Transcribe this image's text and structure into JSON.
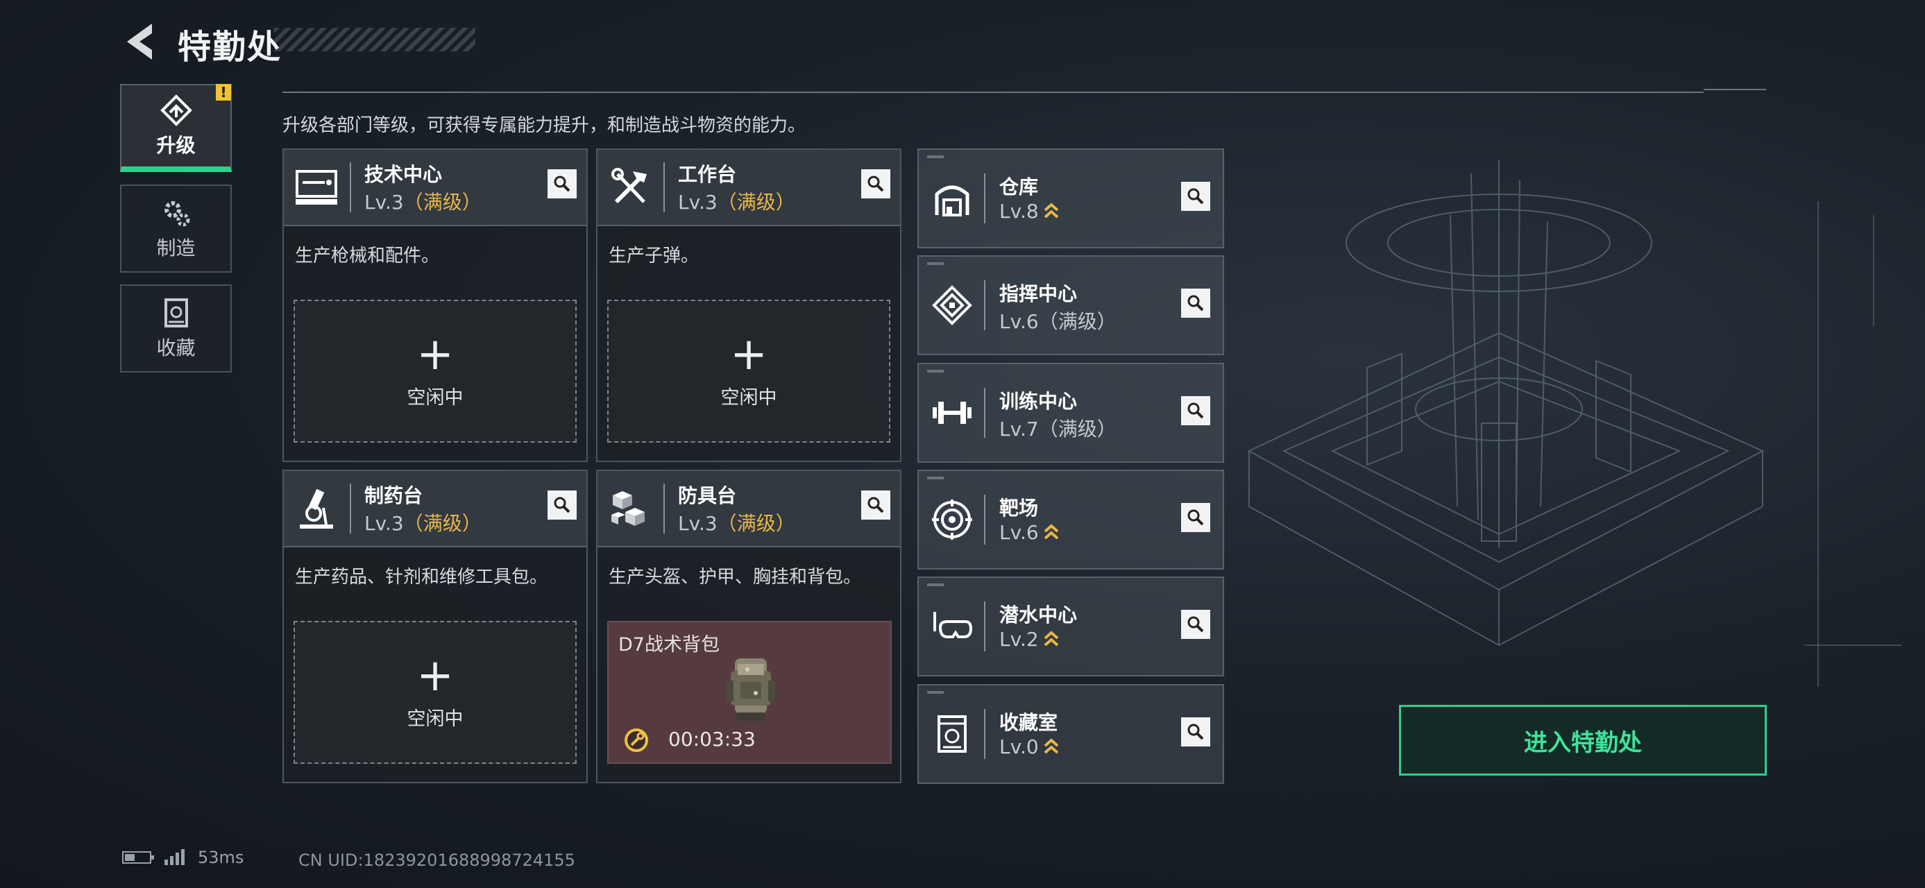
{
  "header": {
    "title": "特勤处"
  },
  "tabs": [
    {
      "label": "升级",
      "active": true,
      "icon": "upgrade-icon"
    },
    {
      "label": "制造",
      "active": false,
      "icon": "gear-icon"
    },
    {
      "label": "收藏",
      "active": false,
      "icon": "collection-icon"
    }
  ],
  "alert_badge": "!",
  "description": "升级各部门等级，可获得专属能力提升，和制造战斗物资的能力。",
  "workshops": [
    {
      "name": "技术中心",
      "level": "Lv.3",
      "max_label": "（满级）",
      "desc": "生产枪械和配件。",
      "slot_label": "空闲中",
      "plus": "+",
      "icon": "monitor-icon"
    },
    {
      "name": "工作台",
      "level": "Lv.3",
      "max_label": "（满级）",
      "desc": "生产子弹。",
      "slot_label": "空闲中",
      "plus": "+",
      "icon": "tools-icon"
    },
    {
      "name": "制药台",
      "level": "Lv.3",
      "max_label": "（满级）",
      "desc": "生产药品、针剂和维修工具包。",
      "slot_label": "空闲中",
      "plus": "+",
      "icon": "microscope-icon"
    },
    {
      "name": "防具台",
      "level": "Lv.3",
      "max_label": "（满级）",
      "desc": "生产头盔、护甲、胸挂和背包。",
      "icon": "armor-icon",
      "crafting": {
        "item": "D7战术背包",
        "time": "00:03:33"
      }
    }
  ],
  "facilities": [
    {
      "name": "仓库",
      "level": "Lv.8",
      "max_label": "",
      "upgradable": true,
      "icon": "warehouse-icon"
    },
    {
      "name": "指挥中心",
      "level": "Lv.6",
      "max_label": "（满级）",
      "upgradable": false,
      "icon": "command-icon"
    },
    {
      "name": "训练中心",
      "level": "Lv.7",
      "max_label": "（满级）",
      "upgradable": false,
      "icon": "dumbbell-icon"
    },
    {
      "name": "靶场",
      "level": "Lv.6",
      "max_label": "",
      "upgradable": true,
      "icon": "target-icon"
    },
    {
      "name": "潜水中心",
      "level": "Lv.2",
      "max_label": "",
      "upgradable": true,
      "icon": "diving-mask-icon"
    },
    {
      "name": "收藏室",
      "level": "Lv.0",
      "max_label": "",
      "upgradable": true,
      "icon": "collection-room-icon"
    }
  ],
  "enter_button": "进入特勤处",
  "status": {
    "ping": "53ms",
    "uid": "CN UID:18239201688998724155"
  },
  "colors": {
    "accent": "#2fd08a",
    "max_level": "#e8b64a",
    "alert": "#f1c232",
    "crafting_bg": "#553b3f"
  }
}
